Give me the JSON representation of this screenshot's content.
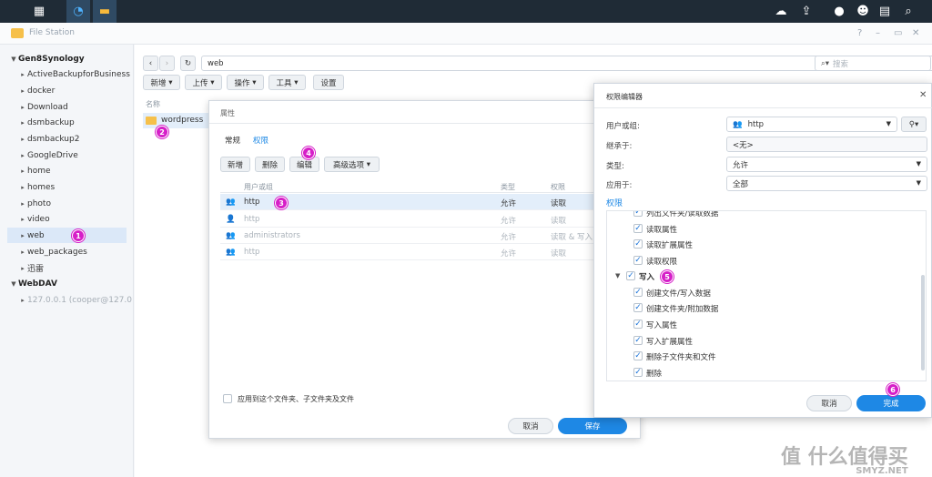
{
  "window": {
    "title": "File Station"
  },
  "sidebar": {
    "root": "Gen8Synology",
    "items": [
      "ActiveBackupforBusiness",
      "docker",
      "Download",
      "dsmbackup",
      "dsmbackup2",
      "GoogleDrive",
      "home",
      "homes",
      "photo",
      "video",
      "web",
      "web_packages",
      "迅雷"
    ],
    "webdav_root": "WebDAV",
    "webdav_item": "127.0.0.1 (cooper@127.0"
  },
  "toolbar": {
    "path": "web",
    "search_placeholder": "搜索",
    "buttons": [
      "新增",
      "上传",
      "操作",
      "工具",
      "设置"
    ]
  },
  "files": {
    "column_name": "名称",
    "item": "wordpress"
  },
  "properties_dialog": {
    "title": "属性",
    "tabs": [
      "常规",
      "权限"
    ],
    "buttons": [
      "新增",
      "删除",
      "编辑",
      "高级选项"
    ],
    "columns": [
      "用户或组",
      "类型",
      "权限"
    ],
    "rows": [
      {
        "user": "http",
        "type": "允许",
        "perm": "读取"
      },
      {
        "user": "http",
        "type": "允许",
        "perm": "读取"
      },
      {
        "user": "administrators",
        "type": "允许",
        "perm": "读取 & 写入"
      },
      {
        "user": "http",
        "type": "允许",
        "perm": "读取"
      }
    ],
    "apply_label": "应用到这个文件夹、子文件夹及文件",
    "cancel": "取消",
    "save": "保存"
  },
  "permission_editor": {
    "title": "权限编辑器",
    "user_label": "用户或组:",
    "user_value": "http",
    "inherit_label": "继承于:",
    "inherit_value": "<无>",
    "type_label": "类型:",
    "type_value": "允许",
    "apply_label": "应用于:",
    "apply_value": "全部",
    "section": "权限",
    "partial_item": "列出文件夹/读取数据",
    "read_items": [
      "读取属性",
      "读取扩展属性",
      "读取权限"
    ],
    "write_group": "写入",
    "write_items": [
      "创建文件/写入数据",
      "创建文件夹/附加数据",
      "写入属性",
      "写入扩展属性",
      "删除子文件夹和文件",
      "删除"
    ],
    "cancel": "取消",
    "done": "完成"
  },
  "badges": [
    "1",
    "2",
    "3",
    "4",
    "5",
    "6"
  ],
  "watermark": "值 什么值得买",
  "watermark_sub": "SMYZ.NET",
  "colors": {
    "accent": "#1e88e5",
    "badge": "#d61fc8",
    "taskbar": "#1f2b36"
  }
}
